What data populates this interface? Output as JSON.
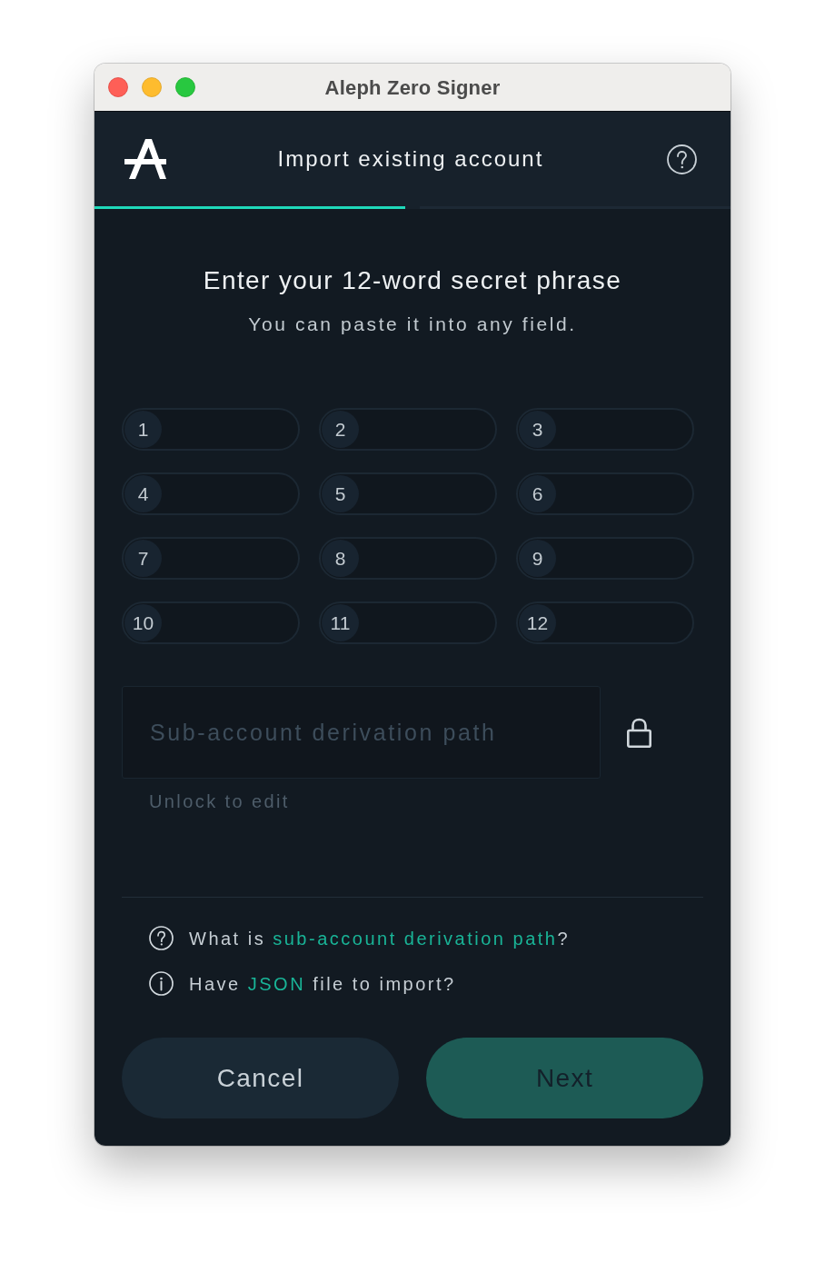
{
  "window": {
    "title": "Aleph Zero Signer"
  },
  "header": {
    "title": "Import existing account"
  },
  "steps": [
    {
      "completed": true
    },
    {
      "completed": false
    }
  ],
  "intro": {
    "heading": "Enter your 12-word secret phrase",
    "subheading": "You can paste it into any field."
  },
  "words": [
    {
      "number": "1"
    },
    {
      "number": "2"
    },
    {
      "number": "3"
    },
    {
      "number": "4"
    },
    {
      "number": "5"
    },
    {
      "number": "6"
    },
    {
      "number": "7"
    },
    {
      "number": "8"
    },
    {
      "number": "9"
    },
    {
      "number": "10"
    },
    {
      "number": "11"
    },
    {
      "number": "12"
    }
  ],
  "derivation_path": {
    "placeholder": "Sub-account derivation path",
    "hint": "Unlock to edit",
    "locked": true
  },
  "help_links": [
    {
      "kind": "question",
      "prefix": "What is ",
      "link": "sub-account derivation path",
      "suffix": "?"
    },
    {
      "kind": "info",
      "prefix": "Have ",
      "link": "JSON",
      "suffix": " file to import?"
    }
  ],
  "buttons": [
    {
      "label": "Cancel",
      "kind": "secondary",
      "disabled": false
    },
    {
      "label": "Next",
      "kind": "primary",
      "disabled": true
    }
  ]
}
